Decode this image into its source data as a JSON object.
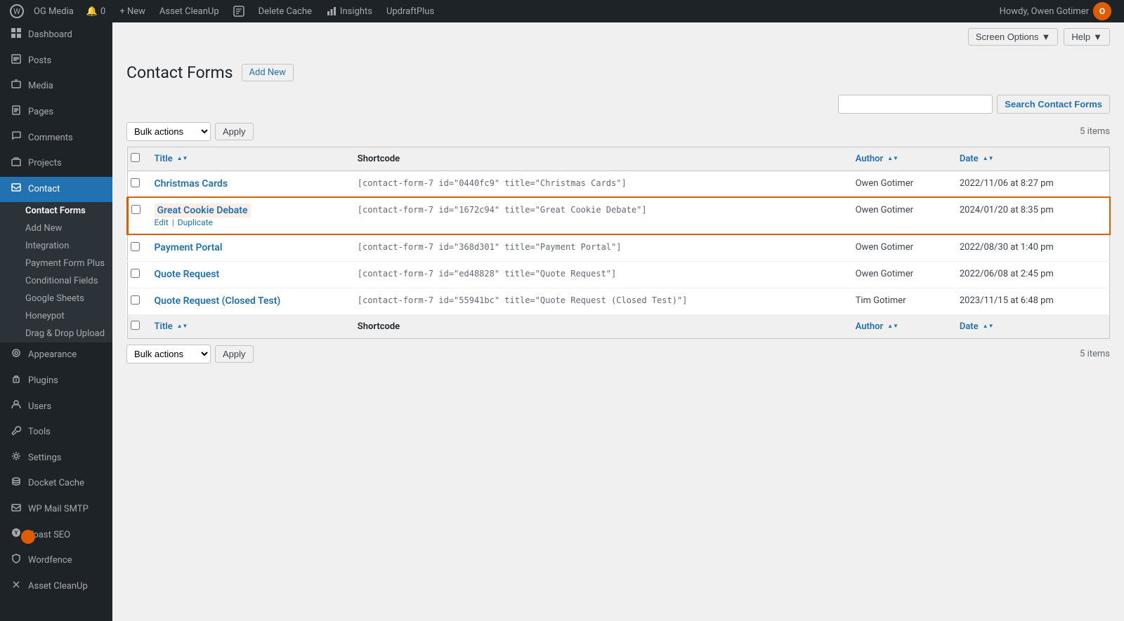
{
  "adminbar": {
    "logo": "⊞",
    "site_name": "OG Media",
    "notifications_icon": "🔔",
    "notifications_count": "0",
    "new_label": "+ New",
    "asset_cleanup": "Asset CleanUp",
    "cf7_icon": "📋",
    "delete_cache": "Delete Cache",
    "insights": "Insights",
    "updraftplus": "UpdraftPlus",
    "howdy": "Howdy, Owen Gotimer",
    "avatar_initials": "O"
  },
  "top_bar": {
    "screen_options": "Screen Options",
    "screen_options_arrow": "▼",
    "help": "Help",
    "help_arrow": "▼"
  },
  "page": {
    "title": "Contact Forms",
    "add_new": "Add New"
  },
  "search": {
    "placeholder": "",
    "button_label": "Search Contact Forms"
  },
  "table_top": {
    "bulk_actions_label": "Bulk actions",
    "apply_label": "Apply",
    "items_count": "5 items"
  },
  "table_bottom": {
    "bulk_actions_label": "Bulk actions",
    "apply_label": "Apply",
    "items_count": "5 items"
  },
  "columns": {
    "title": "Title",
    "shortcode": "Shortcode",
    "author": "Author",
    "date": "Date"
  },
  "rows": [
    {
      "id": 1,
      "title": "Christmas Cards",
      "shortcode": "[contact-form-7 id=\"0440fc9\" title=\"Christmas Cards\"]",
      "author": "Owen Gotimer",
      "date": "2022/11/06 at 8:27 pm",
      "highlighted": false,
      "edit_label": "Edit",
      "duplicate_label": "Duplicate"
    },
    {
      "id": 2,
      "title": "Great Cookie Debate",
      "shortcode": "[contact-form-7 id=\"1672c94\" title=\"Great Cookie Debate\"]",
      "author": "Owen Gotimer",
      "date": "2024/01/20 at 8:35 pm",
      "highlighted": true,
      "edit_label": "Edit",
      "duplicate_label": "Duplicate"
    },
    {
      "id": 3,
      "title": "Payment Portal",
      "shortcode": "[contact-form-7 id=\"368d301\" title=\"Payment Portal\"]",
      "author": "Owen Gotimer",
      "date": "2022/08/30 at 1:40 pm",
      "highlighted": false,
      "edit_label": "Edit",
      "duplicate_label": "Duplicate"
    },
    {
      "id": 4,
      "title": "Quote Request",
      "shortcode": "[contact-form-7 id=\"ed48828\" title=\"Quote Request\"]",
      "author": "Owen Gotimer",
      "date": "2022/06/08 at 2:45 pm",
      "highlighted": false,
      "edit_label": "Edit",
      "duplicate_label": "Duplicate"
    },
    {
      "id": 5,
      "title": "Quote Request (Closed Test)",
      "shortcode": "[contact-form-7 id=\"55941bc\" title=\"Quote Request (Closed Test)\"]",
      "author": "Tim Gotimer",
      "date": "2023/11/15 at 6:48 pm",
      "highlighted": false,
      "edit_label": "Edit",
      "duplicate_label": "Duplicate"
    }
  ],
  "sidebar": {
    "items": [
      {
        "icon": "⊞",
        "label": "Dashboard",
        "name": "dashboard",
        "current": false
      },
      {
        "icon": "📝",
        "label": "Posts",
        "name": "posts",
        "current": false
      },
      {
        "icon": "🖼",
        "label": "Media",
        "name": "media",
        "current": false
      },
      {
        "icon": "📄",
        "label": "Pages",
        "name": "pages",
        "current": false
      },
      {
        "icon": "💬",
        "label": "Comments",
        "name": "comments",
        "current": false
      },
      {
        "icon": "📁",
        "label": "Projects",
        "name": "projects",
        "current": false
      },
      {
        "icon": "✉",
        "label": "Contact",
        "name": "contact",
        "current": true
      }
    ],
    "contact_submenu": [
      {
        "label": "Contact Forms",
        "name": "contact-forms",
        "current": true
      },
      {
        "label": "Add New",
        "name": "add-new",
        "current": false
      },
      {
        "label": "Integration",
        "name": "integration",
        "current": false
      },
      {
        "label": "Payment Form Plus",
        "name": "payment-form-plus",
        "current": false
      },
      {
        "label": "Conditional Fields",
        "name": "conditional-fields",
        "current": false
      },
      {
        "label": "Google Sheets",
        "name": "google-sheets",
        "current": false
      },
      {
        "label": "Honeypot",
        "name": "honeypot",
        "current": false
      },
      {
        "label": "Drag & Drop Upload",
        "name": "drag-drop-upload",
        "current": false
      }
    ],
    "bottom_items": [
      {
        "icon": "🎨",
        "label": "Appearance",
        "name": "appearance",
        "current": false
      },
      {
        "icon": "🔌",
        "label": "Plugins",
        "name": "plugins",
        "current": false
      },
      {
        "icon": "👤",
        "label": "Users",
        "name": "users",
        "current": false
      },
      {
        "icon": "🔧",
        "label": "Tools",
        "name": "tools",
        "current": false
      },
      {
        "icon": "⚙",
        "label": "Settings",
        "name": "settings",
        "current": false
      },
      {
        "icon": "📦",
        "label": "Docket Cache",
        "name": "docket-cache",
        "current": false
      },
      {
        "icon": "📧",
        "label": "WP Mail SMTP",
        "name": "wp-mail-smtp",
        "current": false
      },
      {
        "icon": "🟢",
        "label": "Yoast SEO",
        "name": "yoast-seo",
        "current": false
      },
      {
        "icon": "🛡",
        "label": "Wordfence",
        "name": "wordfence",
        "current": false
      },
      {
        "icon": "🧹",
        "label": "Asset CleanUp",
        "name": "asset-cleanup-menu",
        "current": false
      }
    ]
  },
  "accent_color": "#e05c00",
  "link_color": "#2271b1"
}
